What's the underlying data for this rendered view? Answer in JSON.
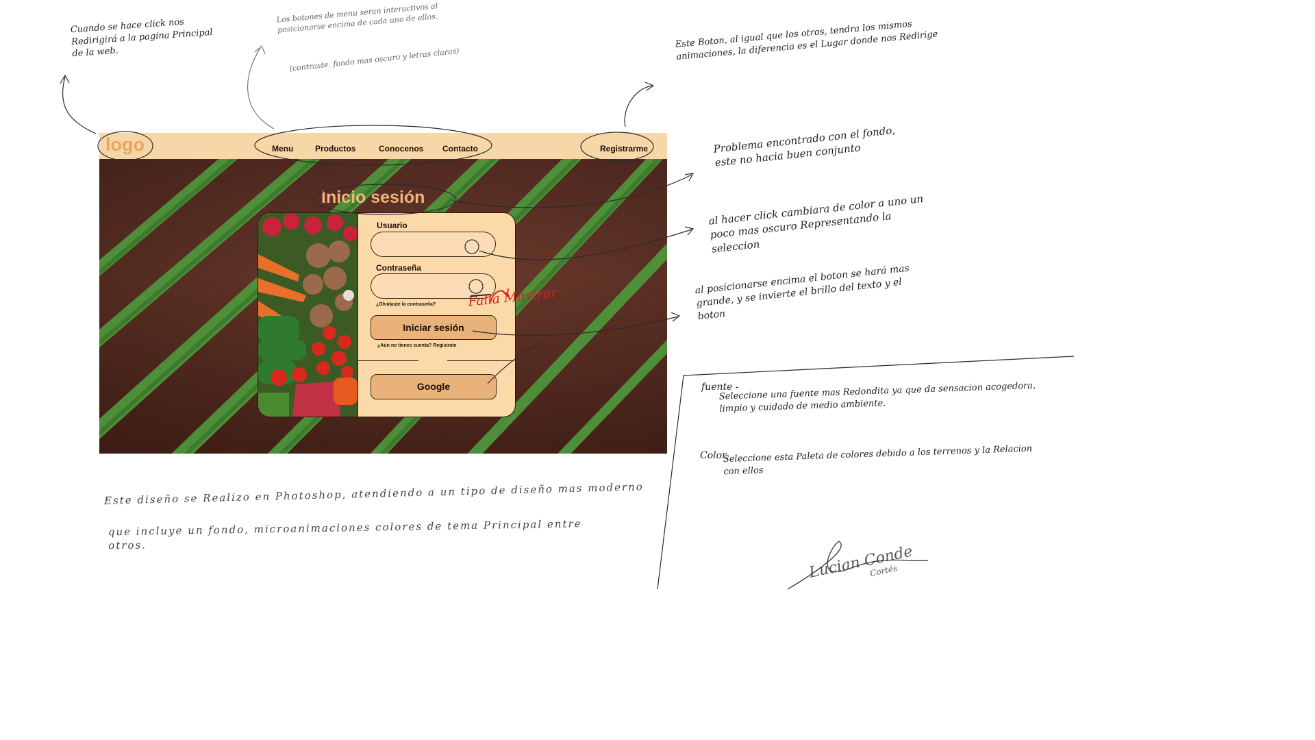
{
  "header": {
    "logo": "logo",
    "nav": [
      "Menu",
      "Productos",
      "Conocenos",
      "Contacto"
    ],
    "register": "Registrarme"
  },
  "login": {
    "title": "Inicio sesión",
    "user_label": "Usuario",
    "password_label": "Contraseña",
    "forgot_link": "¿Olvidaste la contraseña?",
    "login_button": "Iniciar sesión",
    "signup_link": "¿Aún no tienes cuenta? Registrate",
    "google_button": "Google"
  },
  "annotations": {
    "logo_note": "Cuando se hace click nos Redirigirá a la pagina Principal de la web.",
    "menu_note": "Los botones de menu seran interactivos al posicionarse encima de cada uno de ellos.",
    "menu_note_2": "(contraste. fondo mas oscuro y letras claras)",
    "register_note": "Este Boton, al igual que los otros, tendra los mismos animaciones, la diferencia es el Lugar donde nos Redirige",
    "background_note": "Problema encontrado con el fondo, este no hacia buen conjunto",
    "input_note": "al hacer click cambiara de color a uno un poco mas oscuro Representando la seleccion",
    "button_note": "al posicionarse encima el boton se hará mas grande, y se invierte el brillo del texto y el boton",
    "font_title": "fuente -",
    "font_note": "Seleccione una fuente mas Redondita ya que da sensacion acogedora, limpio y cuidado de medio ambiente.",
    "color_title": "Color.",
    "color_note": "Seleccione esta Paleta de colores debido a los terrenos y la Relacion con ellos",
    "bottom_note_1": "Este diseño se Realizo en Photoshop, atendiendo a un tipo de diseño mas moderno",
    "bottom_note_2": "que incluye un fondo, microanimaciones colores de tema Principal entre otros.",
    "error_mark": "Falla Mostrar",
    "signature": "Lucian Conde",
    "signature_sub": "Cortés"
  },
  "colors": {
    "header_bg": "#f7d7a7",
    "logo": "#e3a766",
    "card_bg": "#fbd9a9",
    "button_bg": "#e8b27a",
    "field_rows": "#4f9a3c",
    "soil": "#5e3228",
    "error": "#d22020"
  }
}
